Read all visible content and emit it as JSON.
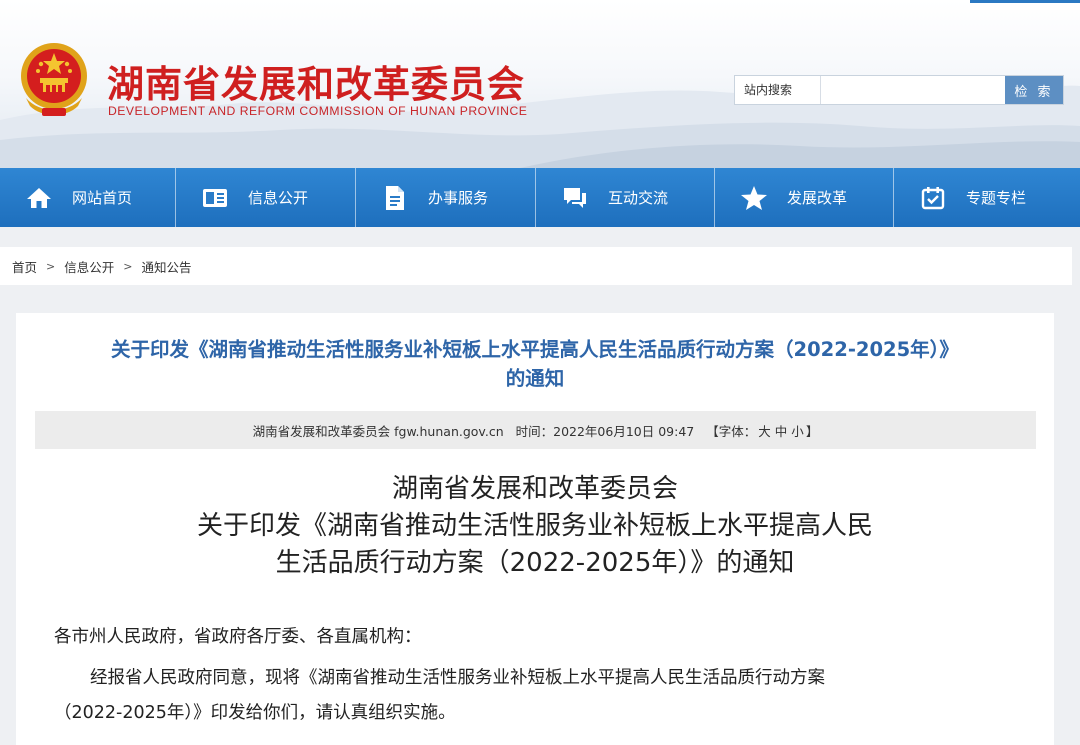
{
  "header": {
    "site_title": "湖南省发展和改革委员会",
    "site_subtitle": "DEVELOPMENT AND REFORM COMMISSION OF HUNAN PROVINCE",
    "search": {
      "label": "站内搜索",
      "placeholder": "",
      "button_label": "检 索"
    },
    "colors": {
      "title_red": "#cf1f1f",
      "nav_blue": "#1e6fbd",
      "accent_blue": "#2e65a8"
    }
  },
  "nav": {
    "items": [
      {
        "label": "网站首页",
        "icon": "home-icon"
      },
      {
        "label": "信息公开",
        "icon": "info-card-icon"
      },
      {
        "label": "办事服务",
        "icon": "document-icon"
      },
      {
        "label": "互动交流",
        "icon": "chat-icon"
      },
      {
        "label": "发展改革",
        "icon": "star-icon"
      },
      {
        "label": "专题专栏",
        "icon": "calendar-check-icon"
      }
    ]
  },
  "breadcrumb": {
    "items": [
      "首页",
      "信息公开",
      "通知公告"
    ],
    "separator": ">"
  },
  "article": {
    "title_line1": "关于印发《湖南省推动生活性服务业补短板上水平提高人民生活品质行动方案（2022-2025年）》",
    "title_line2": "的通知",
    "meta": {
      "source": "湖南省发展和改革委员会 fgw.hunan.gov.cn",
      "time": "时间：2022年06月10日 09:47",
      "font_label": "【字体：",
      "font_large": "大",
      "font_medium": "中",
      "font_small": "小",
      "font_end": "】"
    },
    "doc_heading": {
      "line1": "湖南省发展和改革委员会",
      "line2": "关于印发《湖南省推动生活性服务业补短板上水平提高人民",
      "line3": "生活品质行动方案（2022-2025年）》的通知"
    },
    "addressee": "各市州人民政府，省政府各厅委、各直属机构：",
    "body_line1": "经报省人民政府同意，现将《湖南省推动生活性服务业补短板上水平提高人民生活品质行动方案",
    "body_line2": "（2022-2025年）》印发给你们，请认真组织实施。"
  }
}
